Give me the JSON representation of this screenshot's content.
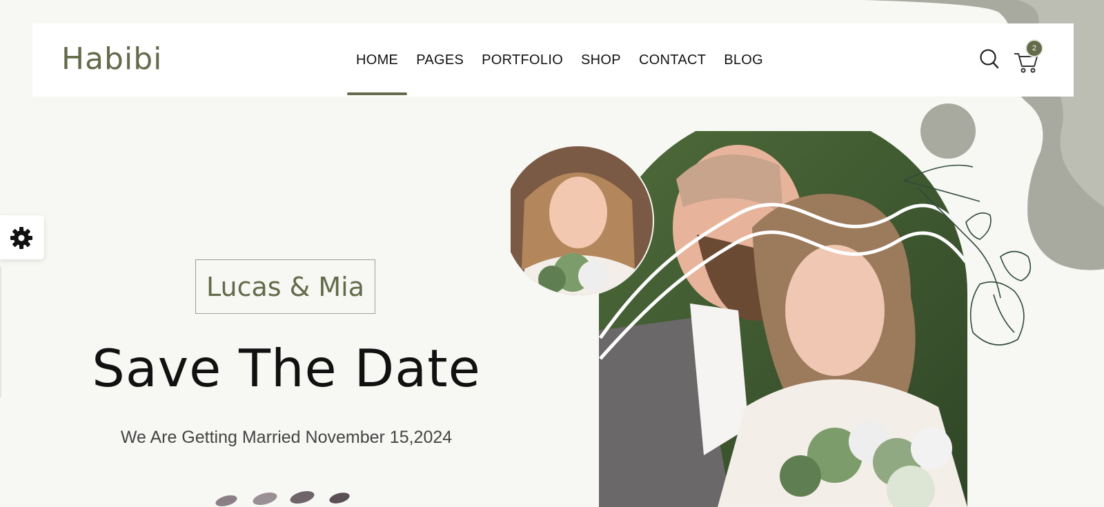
{
  "header": {
    "logo": "Habibi",
    "nav": [
      "HOME",
      "PAGES",
      "PORTFOLIO",
      "SHOP",
      "CONTACT",
      "BLOG"
    ],
    "active_nav": "HOME",
    "cart_count": "2"
  },
  "hero": {
    "names": "Lucas & Mia",
    "title": "Save The Date",
    "subtitle": "We Are Getting Married November 15,2024"
  },
  "colors": {
    "accent": "#636b4a",
    "background": "#f7f8f4",
    "blob": "#a8aa9f"
  },
  "icons": [
    "search-icon",
    "cart-icon",
    "gear-icon"
  ]
}
